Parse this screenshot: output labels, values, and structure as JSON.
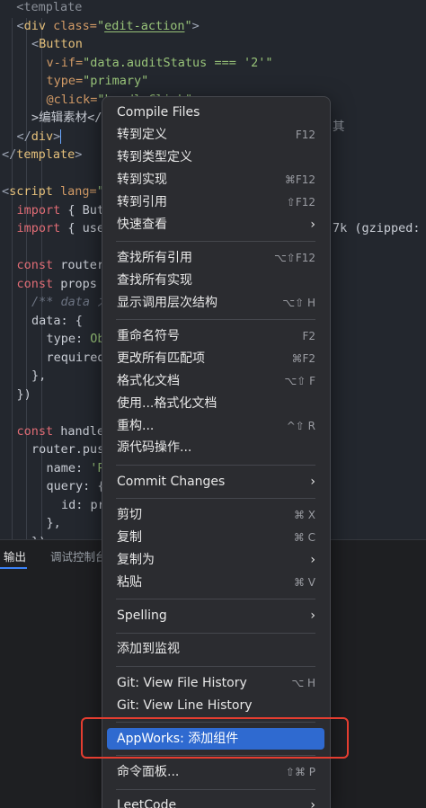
{
  "editor": {
    "lines": [
      {
        "indent": 0,
        "tokens": [
          {
            "t": "  <template",
            "c": "faded"
          }
        ]
      },
      {
        "indent": 1,
        "tokens": [
          {
            "t": "<",
            "c": "punc"
          },
          {
            "t": "div",
            "c": "tag"
          },
          {
            "t": " class=",
            "c": "attr"
          },
          {
            "t": "\"",
            "c": "str"
          },
          {
            "t": "edit-action",
            "c": "str",
            "u": true
          },
          {
            "t": "\"",
            "c": "str"
          },
          {
            "t": ">",
            "c": "punc"
          }
        ]
      },
      {
        "indent": 2,
        "tokens": [
          {
            "t": "<",
            "c": "punc"
          },
          {
            "t": "Button",
            "c": "tag"
          }
        ]
      },
      {
        "indent": 3,
        "tokens": [
          {
            "t": "v-if=",
            "c": "attr"
          },
          {
            "t": "\"data.auditStatus === '2'\"",
            "c": "str"
          }
        ]
      },
      {
        "indent": 3,
        "tokens": [
          {
            "t": "type=",
            "c": "attr"
          },
          {
            "t": "\"primary\"",
            "c": "str"
          }
        ]
      },
      {
        "indent": 3,
        "tokens": [
          {
            "t": "@click=",
            "c": "attr"
          },
          {
            "t": "\"handleClick\"",
            "c": "str"
          }
        ]
      },
      {
        "indent": 2,
        "tokens": [
          {
            "t": ">编辑素材</",
            "c": "plain"
          }
        ]
      },
      {
        "indent": 1,
        "tokens": [
          {
            "t": "</",
            "c": "punc"
          },
          {
            "t": "div",
            "c": "tag"
          },
          {
            "t": ">",
            "c": "punc"
          },
          {
            "t": "|",
            "c": "cursor"
          }
        ]
      },
      {
        "indent": 0,
        "tokens": [
          {
            "t": "</",
            "c": "punc"
          },
          {
            "t": "template",
            "c": "tag"
          },
          {
            "t": ">",
            "c": "punc"
          }
        ]
      },
      {
        "indent": 0,
        "tokens": []
      },
      {
        "indent": 0,
        "tokens": [
          {
            "t": "<",
            "c": "punc"
          },
          {
            "t": "script",
            "c": "tag"
          },
          {
            "t": " lang=",
            "c": "attr"
          },
          {
            "t": "\"",
            "c": "str"
          }
        ]
      },
      {
        "indent": 1,
        "tokens": [
          {
            "t": "import",
            "c": "kw"
          },
          {
            "t": " { But",
            "c": "plain"
          }
        ]
      },
      {
        "indent": 1,
        "tokens": [
          {
            "t": "import",
            "c": "kw"
          },
          {
            "t": " { use",
            "c": "plain"
          }
        ]
      },
      {
        "indent": 0,
        "tokens": []
      },
      {
        "indent": 1,
        "tokens": [
          {
            "t": "const",
            "c": "kw"
          },
          {
            "t": " router",
            "c": "plain"
          }
        ]
      },
      {
        "indent": 1,
        "tokens": [
          {
            "t": "const",
            "c": "kw"
          },
          {
            "t": " props",
            "c": "plain"
          }
        ]
      },
      {
        "indent": 2,
        "tokens": [
          {
            "t": "/** data 为",
            "c": "comment"
          }
        ]
      },
      {
        "indent": 2,
        "tokens": [
          {
            "t": "data: {",
            "c": "plain"
          }
        ]
      },
      {
        "indent": 3,
        "tokens": [
          {
            "t": "type: ",
            "c": "plain"
          },
          {
            "t": "Ob",
            "c": "str"
          }
        ]
      },
      {
        "indent": 3,
        "tokens": [
          {
            "t": "required",
            "c": "plain"
          }
        ]
      },
      {
        "indent": 2,
        "tokens": [
          {
            "t": "},",
            "c": "plain"
          }
        ]
      },
      {
        "indent": 1,
        "tokens": [
          {
            "t": "})",
            "c": "plain"
          }
        ]
      },
      {
        "indent": 0,
        "tokens": []
      },
      {
        "indent": 1,
        "tokens": [
          {
            "t": "const",
            "c": "kw"
          },
          {
            "t": " handle",
            "c": "plain"
          }
        ]
      },
      {
        "indent": 2,
        "tokens": [
          {
            "t": "router.pus",
            "c": "plain"
          }
        ]
      },
      {
        "indent": 3,
        "tokens": [
          {
            "t": "name: ",
            "c": "plain"
          },
          {
            "t": "'P",
            "c": "str"
          }
        ]
      },
      {
        "indent": 3,
        "tokens": [
          {
            "t": "query: {",
            "c": "plain"
          }
        ]
      },
      {
        "indent": 4,
        "tokens": [
          {
            "t": "id: pr",
            "c": "plain"
          }
        ]
      },
      {
        "indent": 3,
        "tokens": [
          {
            "t": "},",
            "c": "plain"
          }
        ]
      },
      {
        "indent": 2,
        "tokens": [
          {
            "t": "})",
            "c": "plain"
          }
        ]
      }
    ],
    "right_fragments": [
      {
        "text": "7k (gzipped: 1",
        "line": 12
      },
      {
        "text": "其",
        "line": 6
      }
    ]
  },
  "panel": {
    "tabs": [
      {
        "label": "输出",
        "active": true
      },
      {
        "label": "调试控制台",
        "active": false
      }
    ]
  },
  "menu": {
    "groups": [
      [
        {
          "label": "Compile Files",
          "shortcut": "",
          "submenu": false
        },
        {
          "label": "转到定义",
          "shortcut": "F12",
          "submenu": false
        },
        {
          "label": "转到类型定义",
          "shortcut": "",
          "submenu": false
        },
        {
          "label": "转到实现",
          "shortcut": "⌘F12",
          "submenu": false
        },
        {
          "label": "转到引用",
          "shortcut": "⇧F12",
          "submenu": false
        },
        {
          "label": "快速查看",
          "shortcut": "",
          "submenu": true
        }
      ],
      [
        {
          "label": "查找所有引用",
          "shortcut": "⌥⇧F12",
          "submenu": false
        },
        {
          "label": "查找所有实现",
          "shortcut": "",
          "submenu": false
        },
        {
          "label": "显示调用层次结构",
          "shortcut": "⌥⇧ H",
          "submenu": false
        }
      ],
      [
        {
          "label": "重命名符号",
          "shortcut": "F2",
          "submenu": false
        },
        {
          "label": "更改所有匹配项",
          "shortcut": "⌘F2",
          "submenu": false
        },
        {
          "label": "格式化文档",
          "shortcut": "⌥⇧ F",
          "submenu": false
        },
        {
          "label": "使用...格式化文档",
          "shortcut": "",
          "submenu": false
        },
        {
          "label": "重构...",
          "shortcut": "^⇧ R",
          "submenu": false
        },
        {
          "label": "源代码操作...",
          "shortcut": "",
          "submenu": false
        }
      ],
      [
        {
          "label": "Commit Changes",
          "shortcut": "",
          "submenu": true
        }
      ],
      [
        {
          "label": "剪切",
          "shortcut": "⌘ X",
          "submenu": false
        },
        {
          "label": "复制",
          "shortcut": "⌘ C",
          "submenu": false
        },
        {
          "label": "复制为",
          "shortcut": "",
          "submenu": true
        },
        {
          "label": "粘贴",
          "shortcut": "⌘ V",
          "submenu": false
        }
      ],
      [
        {
          "label": "Spelling",
          "shortcut": "",
          "submenu": true
        }
      ],
      [
        {
          "label": "添加到监视",
          "shortcut": "",
          "submenu": false
        }
      ],
      [
        {
          "label": "Git: View File History",
          "shortcut": "⌥ H",
          "submenu": false
        },
        {
          "label": "Git: View Line History",
          "shortcut": "",
          "submenu": false
        }
      ],
      [
        {
          "label": "AppWorks: 添加组件",
          "shortcut": "",
          "submenu": false,
          "highlighted": true
        }
      ],
      [
        {
          "label": "命令面板...",
          "shortcut": "⇧⌘ P",
          "submenu": false
        }
      ],
      [
        {
          "label": "LeetCode",
          "shortcut": "",
          "submenu": true
        }
      ]
    ],
    "arrow_glyph": "›"
  },
  "colors": {
    "highlight": "#2f6ad0",
    "annotation_box": "#e43d30"
  }
}
